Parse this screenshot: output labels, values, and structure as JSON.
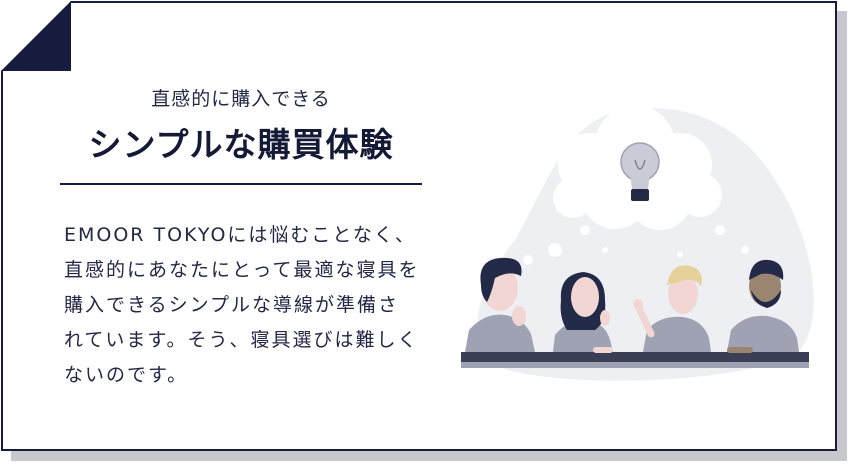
{
  "card": {
    "subtitle": "直感的に購入できる",
    "title": "シンプルな購買体験",
    "body": "EMOOR TOKYOには悩むことなく、直感的にあなたにとって最適な寝具を購入できるシンプルな導線が準備されています。そう、寝具選びは難しくないのです。"
  },
  "colors": {
    "navy": "#151c3d",
    "text": "#222845",
    "shadow": "#c7c8cc",
    "blob": "#eeeff3",
    "figure": "#9ea2b2",
    "skin": "#f1d6d3"
  },
  "illustration": {
    "subject": "four-people-brainstorming-idea-bulb"
  }
}
